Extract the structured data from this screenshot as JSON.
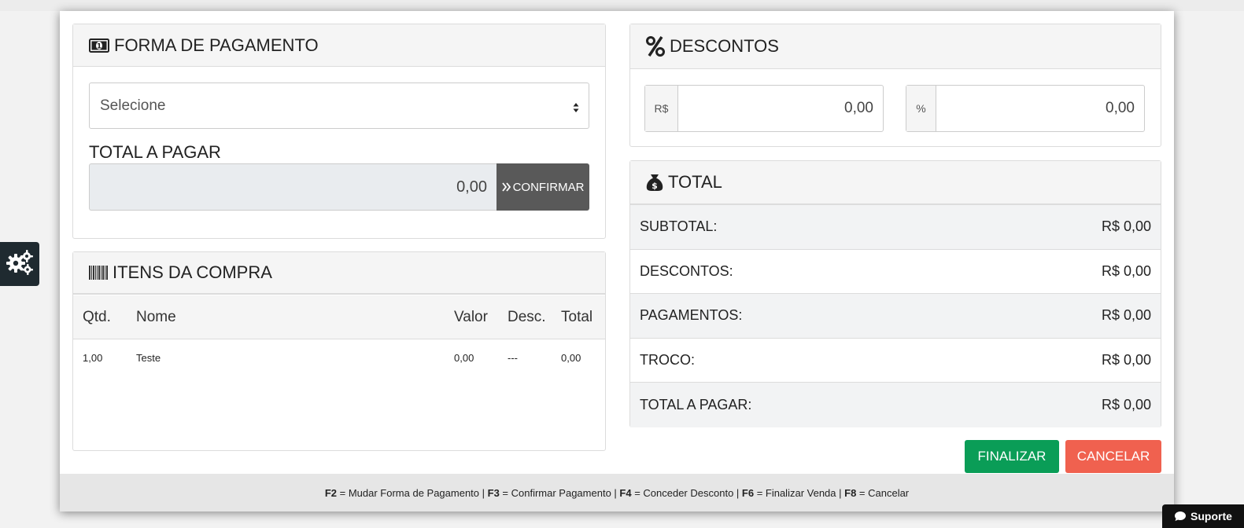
{
  "forma": {
    "title": "FORMA DE PAGAMENTO",
    "select_value": "Selecione",
    "total_label": "TOTAL A PAGAR",
    "total_value": "0,00",
    "confirm_label": "CONFIRMAR"
  },
  "itens": {
    "title": "ITENS DA COMPRA",
    "headers": [
      "Qtd.",
      "Nome",
      "Valor",
      "Desc.",
      "Total"
    ],
    "rows": [
      {
        "qtd": "1,00",
        "nome": "Teste",
        "valor": "0,00",
        "desc": "---",
        "total": "0,00"
      }
    ]
  },
  "descontos": {
    "title": "DESCONTOS",
    "rs_addon": "R$",
    "rs_value": "0,00",
    "pct_addon": "%",
    "pct_value": "0,00"
  },
  "total": {
    "title": "TOTAL",
    "rows": [
      {
        "label": "SUBTOTAL:",
        "value": "R$ 0,00"
      },
      {
        "label": "DESCONTOS:",
        "value": "R$ 0,00"
      },
      {
        "label": "PAGAMENTOS:",
        "value": "R$ 0,00"
      },
      {
        "label": "TROCO:",
        "value": "R$ 0,00"
      },
      {
        "label": "TOTAL A PAGAR:",
        "value": "R$ 0,00"
      }
    ]
  },
  "buttons": {
    "finalizar": "FINALIZAR",
    "cancelar": "CANCELAR"
  },
  "footer": {
    "items": [
      {
        "key": "F2",
        "text": " = Mudar Forma de Pagamento"
      },
      {
        "key": "F3",
        "text": " = Confirmar Pagamento"
      },
      {
        "key": "F4",
        "text": " = Conceder Desconto"
      },
      {
        "key": "F6",
        "text": " = Finalizar Venda"
      },
      {
        "key": "F8",
        "text": " = Cancelar"
      }
    ],
    "separator": " | "
  },
  "suporte_label": "Suporte",
  "colors": {
    "finalizar": "#0a9d57",
    "cancelar": "#f0614f",
    "confirmar": "#595959",
    "gear_button": "#1f2a30"
  },
  "icons": {
    "forma": "money-bill-icon",
    "itens": "barcode-icon",
    "descontos": "percent-icon",
    "total": "money-bag-icon",
    "confirm": "double-chevron-right-icon",
    "select": "sort-arrows-icon",
    "side": "gears-icon",
    "suporte": "comment-icon"
  }
}
